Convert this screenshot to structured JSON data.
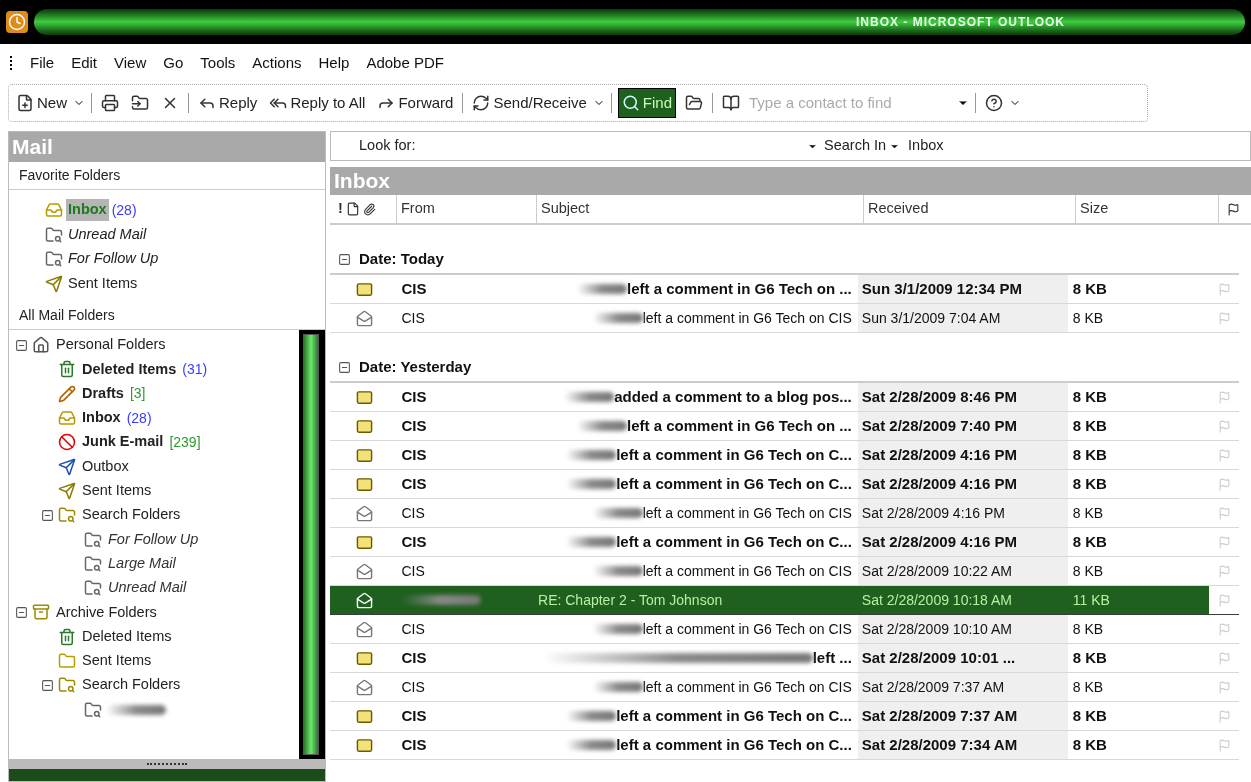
{
  "window": {
    "title": "INBOX - MICROSOFT OUTLOOK"
  },
  "menu": [
    "File",
    "Edit",
    "View",
    "Go",
    "Tools",
    "Actions",
    "Help",
    "Adobe PDF"
  ],
  "toolbar": [
    {
      "kind": "new",
      "label": "New",
      "dropdown": true
    },
    {
      "kind": "separator"
    },
    {
      "kind": "print"
    },
    {
      "kind": "move"
    },
    {
      "kind": "delete"
    },
    {
      "kind": "separator"
    },
    {
      "kind": "reply",
      "label": "Reply"
    },
    {
      "kind": "replyall",
      "label": "Reply to All"
    },
    {
      "kind": "forward",
      "label": "Forward"
    },
    {
      "kind": "separator"
    },
    {
      "kind": "sendreceive",
      "label": "Send/Receive",
      "dropdown": true
    },
    {
      "kind": "separator"
    },
    {
      "kind": "find",
      "label": "Find",
      "selected": true
    },
    {
      "kind": "folder"
    },
    {
      "kind": "separator"
    },
    {
      "kind": "book"
    },
    {
      "kind": "contact",
      "placeholder": "Type a contact to find"
    },
    {
      "kind": "separator"
    },
    {
      "kind": "help",
      "dropdown": true
    }
  ],
  "sidebar": {
    "title": "Mail",
    "favorites_heading": "Favorite Folders",
    "favorites": [
      {
        "name": "Inbox",
        "unread_count": "(28)",
        "kind": "inbox",
        "bold": true,
        "italic": false,
        "selected": true
      },
      {
        "name": "Unread Mail",
        "kind": "search",
        "bold": false,
        "italic": true,
        "selected": false
      },
      {
        "name": "For Follow Up",
        "kind": "search",
        "bold": false,
        "italic": true,
        "selected": false
      },
      {
        "name": "Sent Items",
        "kind": "sent",
        "bold": false,
        "italic": false,
        "selected": false
      }
    ],
    "all_heading": "All Mail Folders",
    "tree": [
      {
        "name": "Personal Folders",
        "kind": "personal",
        "bold": false,
        "italic": false,
        "expanded": true,
        "children": [
          {
            "name": "Deleted Items",
            "unread_count": "(31)",
            "kind": "trash",
            "bold": true,
            "italic": false
          },
          {
            "name": "Drafts",
            "total_count": "[3]",
            "kind": "drafts",
            "bold": true,
            "italic": false
          },
          {
            "name": "Inbox",
            "unread_count": "(28)",
            "kind": "inbox",
            "bold": true,
            "italic": false
          },
          {
            "name": "Junk E-mail",
            "total_count": "[239]",
            "kind": "junk",
            "bold": true,
            "italic": false
          },
          {
            "name": "Outbox",
            "kind": "outbox",
            "bold": false,
            "italic": false
          },
          {
            "name": "Sent Items",
            "kind": "sent",
            "bold": false,
            "italic": false
          },
          {
            "name": "Search Folders",
            "kind": "searchfolder",
            "bold": false,
            "italic": false,
            "expanded": true,
            "children": [
              {
                "name": "For Follow Up",
                "kind": "search",
                "bold": false,
                "italic": true
              },
              {
                "name": "Large Mail",
                "kind": "search",
                "bold": false,
                "italic": true
              },
              {
                "name": "Unread Mail",
                "kind": "search",
                "bold": false,
                "italic": true
              }
            ]
          }
        ]
      },
      {
        "name": "Archive Folders",
        "kind": "archive",
        "bold": false,
        "italic": false,
        "expanded": true,
        "children": [
          {
            "name": "Deleted Items",
            "kind": "trash",
            "bold": false,
            "italic": false
          },
          {
            "name": "Sent Items",
            "kind": "folder",
            "bold": false,
            "italic": false
          },
          {
            "name": "Search Folders",
            "kind": "searchfolder",
            "bold": false,
            "italic": false,
            "expanded": true,
            "children": [
              {
                "kind": "search",
                "redacted": true
              }
            ]
          }
        ]
      }
    ]
  },
  "search": {
    "label": "Look for:",
    "search_in": "Search In",
    "scope": "Inbox"
  },
  "list": {
    "title": "Inbox",
    "importance_header": "!",
    "columns": [
      "From",
      "Subject",
      "Received",
      "Size"
    ],
    "groups": [
      {
        "label": "Date: Today",
        "expanded": true,
        "messages": [
          {
            "kind": "short_blur",
            "unread": true,
            "from": "CIS",
            "subject": "left a comment in G6 Tech on ...",
            "received": "Sun 3/1/2009 12:34 PM",
            "size": "8 KB",
            "selected": false
          },
          {
            "kind": "short_blur",
            "unread": false,
            "from": "CIS",
            "subject": "left a comment in G6 Tech on CIS",
            "received": "Sun 3/1/2009 7:04 AM",
            "size": "8 KB",
            "selected": false
          }
        ]
      },
      {
        "label": "Date: Yesterday",
        "expanded": true,
        "messages": [
          {
            "kind": "short_blur",
            "unread": true,
            "from": "CIS",
            "subject": "added a comment to a blog pos...",
            "received": "Sat 2/28/2009 8:46 PM",
            "size": "8 KB",
            "selected": false
          },
          {
            "kind": "short_blur",
            "unread": true,
            "from": "CIS",
            "subject": "left a comment in G6 Tech on ...",
            "received": "Sat 2/28/2009 7:40 PM",
            "size": "8 KB",
            "selected": false
          },
          {
            "kind": "short_blur",
            "unread": true,
            "from": "CIS",
            "subject": "left a comment in G6 Tech on C...",
            "received": "Sat 2/28/2009 4:16 PM",
            "size": "8 KB",
            "selected": false
          },
          {
            "kind": "short_blur",
            "unread": true,
            "from": "CIS",
            "subject": "left a comment in G6 Tech on C...",
            "received": "Sat 2/28/2009 4:16 PM",
            "size": "8 KB",
            "selected": false
          },
          {
            "kind": "short_blur",
            "unread": false,
            "from": "CIS",
            "subject": "left a comment in G6 Tech on CIS",
            "received": "Sat 2/28/2009 4:16 PM",
            "size": "8 KB",
            "selected": false
          },
          {
            "kind": "short_blur",
            "unread": true,
            "from": "CIS",
            "subject": "left a comment in G6 Tech on C...",
            "received": "Sat 2/28/2009 4:16 PM",
            "size": "8 KB",
            "selected": false
          },
          {
            "kind": "short_blur",
            "unread": false,
            "from": "CIS",
            "subject": "left a comment in G6 Tech on CIS",
            "received": "Sat 2/28/2009 10:22 AM",
            "size": "8 KB",
            "selected": false
          },
          {
            "kind": "sender_blur",
            "unread": false,
            "subject": "RE: Chapter 2  - Tom Johnson",
            "received": "Sat 2/28/2009 10:18 AM",
            "size": "11 KB",
            "selected": true
          },
          {
            "kind": "short_blur",
            "unread": false,
            "from": "CIS",
            "subject": "left a comment in G6 Tech on CIS",
            "received": "Sat 2/28/2009 10:10 AM",
            "size": "8 KB",
            "selected": false
          },
          {
            "kind": "long_blur",
            "unread": true,
            "from": "CIS",
            "subject": "left ...",
            "received": "Sat 2/28/2009 10:01 ...",
            "size": "8 KB",
            "selected": false
          },
          {
            "kind": "short_blur",
            "unread": false,
            "from": "CIS",
            "subject": "left a comment in G6 Tech on CIS",
            "received": "Sat 2/28/2009 7:37 AM",
            "size": "8 KB",
            "selected": false
          },
          {
            "kind": "short_blur",
            "unread": true,
            "from": "CIS",
            "subject": "left a comment in G6 Tech on C...",
            "received": "Sat 2/28/2009 7:37 AM",
            "size": "8 KB",
            "selected": false
          },
          {
            "kind": "short_blur",
            "unread": true,
            "from": "CIS",
            "subject": "left a comment in G6 Tech on C...",
            "received": "Sat 2/28/2009 7:34 AM",
            "size": "8 KB",
            "selected": false
          }
        ]
      }
    ]
  }
}
